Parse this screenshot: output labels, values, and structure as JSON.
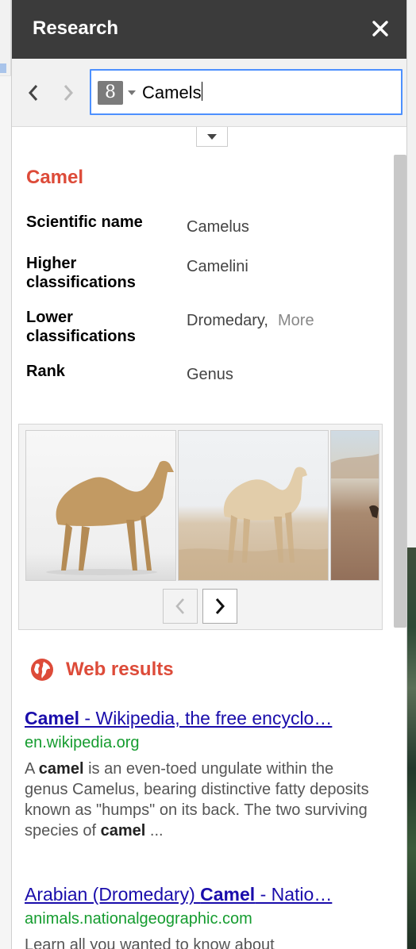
{
  "panel": {
    "title": "Research"
  },
  "search": {
    "engine_glyph": "8",
    "query": "Camels"
  },
  "card": {
    "title": "Camel",
    "facts": [
      {
        "key": "Scientific name",
        "value": "Camelus"
      },
      {
        "key": "Higher classifications",
        "value": "Camelini"
      },
      {
        "key": "Lower classifications",
        "value": "Dromedary,",
        "more": "More"
      },
      {
        "key": "Rank",
        "value": "Genus"
      }
    ]
  },
  "images": {
    "count_visible": 3
  },
  "web": {
    "label": "Web results",
    "results": [
      {
        "title_bold": "Camel",
        "title_rest": " - Wikipedia, the free encyclo…",
        "url": "en.wikipedia.org",
        "snippet_parts": [
          "A ",
          "camel",
          " is an even-toed ungulate within the genus Camelus, bearing distinctive fatty deposits known as \"humps\" on its back. The two surviving species of ",
          "camel",
          " ..."
        ]
      },
      {
        "title_pre": "Arabian (Dromedary) ",
        "title_bold": "Camel",
        "title_rest": " - Natio…",
        "url": "animals.nationalgeographic.com",
        "snippet": "Learn all you wanted to know about"
      }
    ]
  },
  "colors": {
    "header": "#3b3b3b",
    "accent_red": "#dd4b39",
    "link": "#1a0dab",
    "url_green": "#159c2f",
    "focus_blue": "#4d90fe"
  },
  "icons": [
    "close-icon",
    "back-arrow-icon",
    "forward-arrow-icon",
    "google-search-icon",
    "dropdown-caret-icon",
    "globe-icon",
    "carousel-prev-icon",
    "carousel-next-icon"
  ]
}
